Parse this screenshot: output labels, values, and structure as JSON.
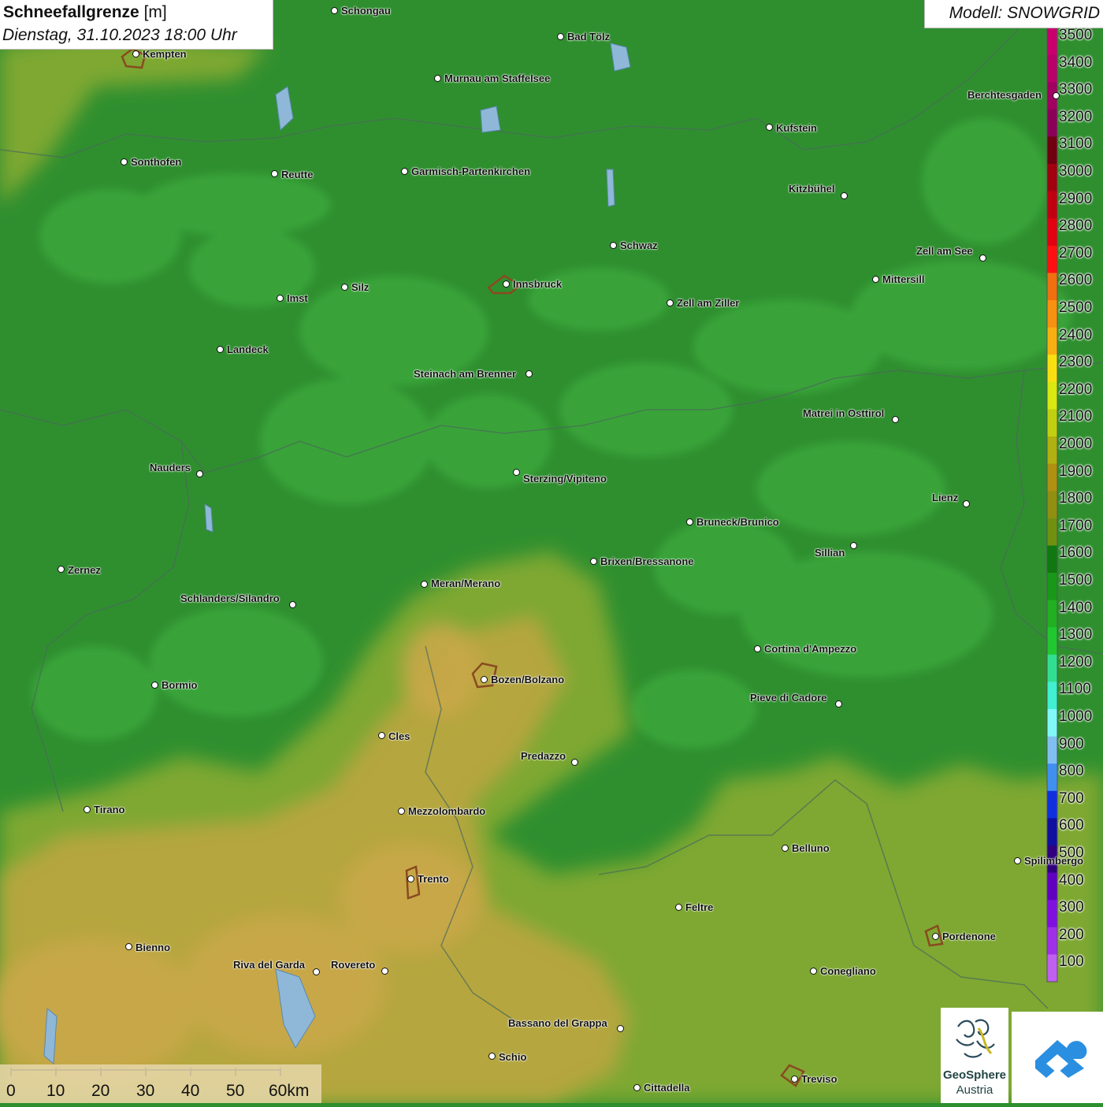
{
  "title": {
    "name": "Schneefallgrenze",
    "unit": "[m]",
    "datetime": "Dienstag, 31.10.2023 18:00 Uhr"
  },
  "model": "Modell: SNOWGRID",
  "legend": {
    "values": [
      "3500",
      "3400",
      "3300",
      "3200",
      "3100",
      "3000",
      "2900",
      "2800",
      "2700",
      "2600",
      "2500",
      "2400",
      "2300",
      "2200",
      "2100",
      "2000",
      "1900",
      "1800",
      "1700",
      "1600",
      "1500",
      "1400",
      "1300",
      "1200",
      "1100",
      "1000",
      "900",
      "800",
      "700",
      "600",
      "500",
      "400",
      "300",
      "200",
      "100"
    ],
    "colors": [
      "#c8006e",
      "#b8006a",
      "#a00060",
      "#8a0058",
      "#700010",
      "#a00010",
      "#c00010",
      "#e00010",
      "#ff1010",
      "#f07010",
      "#f89010",
      "#f8b010",
      "#f8e010",
      "#d8e810",
      "#c0d010",
      "#b0b010",
      "#b09010",
      "#909010",
      "#709010",
      "#107810",
      "#189818",
      "#20b020",
      "#20c830",
      "#30e090",
      "#40f0d0",
      "#80f8f8",
      "#80c0f0",
      "#4090f0",
      "#1030e0",
      "#1010a0",
      "#300080",
      "#6000c0",
      "#8010e0",
      "#a030e8",
      "#c060f0"
    ]
  },
  "cities": [
    {
      "name": "Schongau",
      "dot": [
        424,
        13
      ],
      "lbl": [
        433,
        7
      ]
    },
    {
      "name": "Bad Tölz",
      "dot": [
        711,
        46
      ],
      "lbl": [
        720,
        40
      ]
    },
    {
      "name": "Kempten",
      "dot": [
        172,
        68
      ],
      "lbl": [
        181,
        62
      ]
    },
    {
      "name": "Murnau am Staffelsee",
      "dot": [
        555,
        99
      ],
      "lbl": [
        564,
        93
      ]
    },
    {
      "name": "Kufstein",
      "dot": [
        976,
        161
      ],
      "lbl": [
        985,
        156
      ]
    },
    {
      "name": "Sonthofen",
      "dot": [
        157,
        205
      ],
      "lbl": [
        166,
        199
      ]
    },
    {
      "name": "Reutte",
      "dot": [
        348,
        220
      ],
      "lbl": [
        357,
        215
      ]
    },
    {
      "name": "Garmisch-Partenkirchen",
      "dot": [
        513,
        217
      ],
      "lbl": [
        522,
        211
      ]
    },
    {
      "name": "Kitzbühel",
      "dot": [
        1071,
        248
      ],
      "lbl": [
        1001,
        233
      ]
    },
    {
      "name": "Schwaz",
      "dot": [
        778,
        311
      ],
      "lbl": [
        787,
        305
      ]
    },
    {
      "name": "Zell am See",
      "dot": [
        1247,
        327
      ],
      "lbl": [
        1163,
        312
      ]
    },
    {
      "name": "Mittersill",
      "dot": [
        1111,
        354
      ],
      "lbl": [
        1120,
        348
      ]
    },
    {
      "name": "Innsbruck",
      "dot": [
        642,
        360
      ],
      "lbl": [
        651,
        354
      ]
    },
    {
      "name": "Silz",
      "dot": [
        437,
        364
      ],
      "lbl": [
        446,
        358
      ]
    },
    {
      "name": "Imst",
      "dot": [
        355,
        378
      ],
      "lbl": [
        364,
        372
      ]
    },
    {
      "name": "Zell am Ziller",
      "dot": [
        850,
        384
      ],
      "lbl": [
        859,
        378
      ]
    },
    {
      "name": "Landeck",
      "dot": [
        279,
        443
      ],
      "lbl": [
        288,
        437
      ]
    },
    {
      "name": "Steinach am Brenner",
      "dot": [
        671,
        474
      ],
      "lbl": [
        525,
        468
      ]
    },
    {
      "name": "Matrei in Osttirol",
      "dot": [
        1136,
        532
      ],
      "lbl": [
        1019,
        518
      ]
    },
    {
      "name": "Nauders",
      "dot": [
        253,
        601
      ],
      "lbl": [
        190,
        587
      ]
    },
    {
      "name": "Sterzing/Vipiteno",
      "dot": [
        655,
        599
      ],
      "lbl": [
        664,
        601
      ]
    },
    {
      "name": "Lienz",
      "dot": [
        1226,
        639
      ],
      "lbl": [
        1183,
        625
      ]
    },
    {
      "name": "Bruneck/Brunico",
      "dot": [
        875,
        662
      ],
      "lbl": [
        884,
        656
      ]
    },
    {
      "name": "Sillian",
      "dot": [
        1083,
        692
      ],
      "lbl": [
        1034,
        695
      ]
    },
    {
      "name": "Brixen/Bressanone",
      "dot": [
        753,
        712
      ],
      "lbl": [
        762,
        706
      ]
    },
    {
      "name": "Zernez",
      "dot": [
        77,
        722
      ],
      "lbl": [
        86,
        717
      ]
    },
    {
      "name": "Meran/Merano",
      "dot": [
        538,
        741
      ],
      "lbl": [
        547,
        734
      ]
    },
    {
      "name": "Schlanders/Silandro",
      "dot": [
        371,
        767
      ],
      "lbl": [
        229,
        753
      ]
    },
    {
      "name": "Cortina d'Ampezzo",
      "dot": [
        961,
        823
      ],
      "lbl": [
        970,
        817
      ]
    },
    {
      "name": "Bozen/Bolzano",
      "dot": [
        614,
        862
      ],
      "lbl": [
        623,
        856
      ]
    },
    {
      "name": "Bormio",
      "dot": [
        196,
        869
      ],
      "lbl": [
        205,
        863
      ]
    },
    {
      "name": "Pieve di Cadore",
      "dot": [
        1064,
        893
      ],
      "lbl": [
        952,
        879
      ]
    },
    {
      "name": "Cles",
      "dot": [
        484,
        933
      ],
      "lbl": [
        493,
        928
      ]
    },
    {
      "name": "Predazzo",
      "dot": [
        729,
        967
      ],
      "lbl": [
        661,
        953
      ]
    },
    {
      "name": "Tirano",
      "dot": [
        110,
        1027
      ],
      "lbl": [
        119,
        1021
      ]
    },
    {
      "name": "Mezzolombardo",
      "dot": [
        509,
        1029
      ],
      "lbl": [
        518,
        1023
      ]
    },
    {
      "name": "Belluno",
      "dot": [
        996,
        1076
      ],
      "lbl": [
        1005,
        1070
      ]
    },
    {
      "name": "Spilimbergo",
      "dot": [
        1291,
        1092
      ],
      "lbl": [
        1300,
        1086
      ]
    },
    {
      "name": "Trento",
      "dot": [
        521,
        1115
      ],
      "lbl": [
        530,
        1109
      ]
    },
    {
      "name": "Feltre",
      "dot": [
        861,
        1151
      ],
      "lbl": [
        870,
        1145
      ]
    },
    {
      "name": "Pordenone",
      "dot": [
        1187,
        1188
      ],
      "lbl": [
        1196,
        1182
      ]
    },
    {
      "name": "Bienno",
      "dot": [
        163,
        1201
      ],
      "lbl": [
        172,
        1196
      ]
    },
    {
      "name": "Riva del Garda",
      "dot": [
        401,
        1233
      ],
      "lbl": [
        296,
        1218
      ]
    },
    {
      "name": "Rovereto",
      "dot": [
        488,
        1232
      ],
      "lbl": [
        420,
        1218
      ]
    },
    {
      "name": "Conegliano",
      "dot": [
        1032,
        1232
      ],
      "lbl": [
        1041,
        1226
      ]
    },
    {
      "name": "Bassano del Grappa",
      "dot": [
        787,
        1305
      ],
      "lbl": [
        645,
        1292
      ]
    },
    {
      "name": "Schio",
      "dot": [
        624,
        1340
      ],
      "lbl": [
        633,
        1335
      ]
    },
    {
      "name": "Treviso",
      "dot": [
        1008,
        1369
      ],
      "lbl": [
        1017,
        1363
      ]
    },
    {
      "name": "Cittadella",
      "dot": [
        808,
        1380
      ],
      "lbl": [
        817,
        1374
      ]
    },
    {
      "name": "Berchtesgaden",
      "dot": [
        1340,
        121
      ],
      "lbl": [
        1228,
        114
      ]
    }
  ],
  "scalebar": {
    "labels": [
      "0",
      "10",
      "20",
      "30",
      "40",
      "50",
      "60km"
    ]
  },
  "logos": {
    "geosphere_line1": "GeoSphere",
    "geosphere_line2": "Austria"
  }
}
